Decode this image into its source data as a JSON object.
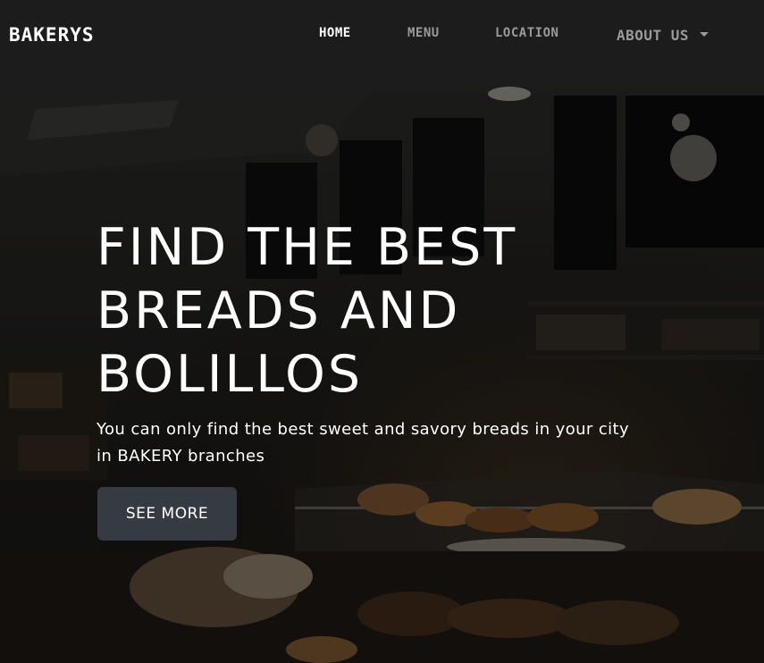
{
  "brand": "BAKERYS",
  "nav": {
    "home": "HOME",
    "menu": "MENU",
    "location": "LOCATION",
    "about": "ABOUT US"
  },
  "hero": {
    "title_line1": "FIND THE BEST",
    "title_line2": "BREADS AND",
    "title_line3": "BOLILLOS",
    "subtitle_line1": "You can only find the best sweet and savory breads in your city",
    "subtitle_line2": "in BAKERY branches",
    "button_label": "SEE MORE"
  },
  "colors": {
    "navbar_bg": "#1c1c1c",
    "button_bg": "#363a42",
    "active_nav": "#ffffff",
    "inactive_nav": "#9a9a9a"
  },
  "icons": {
    "about_dropdown": "caret-down-icon"
  }
}
